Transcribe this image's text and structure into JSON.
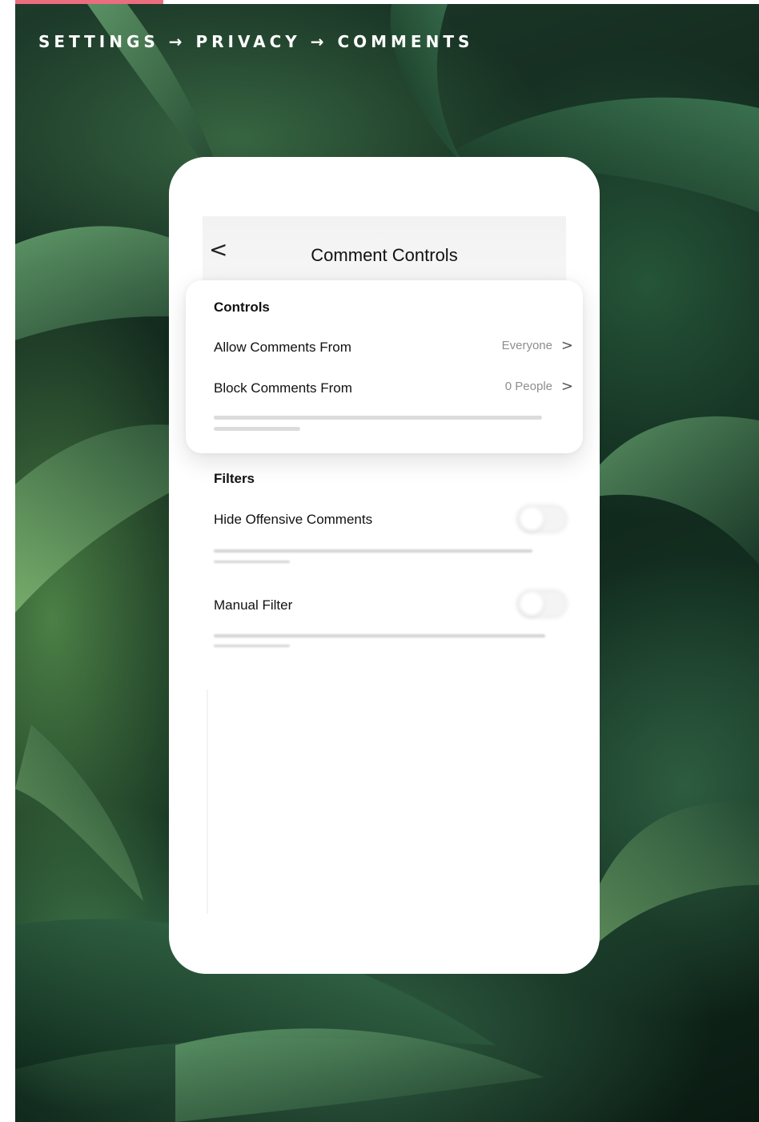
{
  "breadcrumb": "SETTINGS → PRIVACY → COMMENTS",
  "colors": {
    "accent": "#ec6d7f",
    "leaf_dark": "#0f241a",
    "leaf_light": "#5e9c6a",
    "value_gray": "#8e8e8e"
  },
  "nav": {
    "back_icon": "chevron-left-icon",
    "back_glyph": "<",
    "title": "Comment Controls"
  },
  "controls": {
    "heading": "Controls",
    "items": [
      {
        "label": "Allow Comments From",
        "value": "Everyone",
        "chevron": ">"
      },
      {
        "label": "Block Comments From",
        "value": "0 People",
        "chevron": ">"
      }
    ]
  },
  "filters": {
    "heading": "Filters",
    "items": [
      {
        "label": "Hide Offensive Comments",
        "control": "toggle-switch"
      },
      {
        "label": "Manual Filter",
        "control": "toggle-switch"
      }
    ]
  }
}
